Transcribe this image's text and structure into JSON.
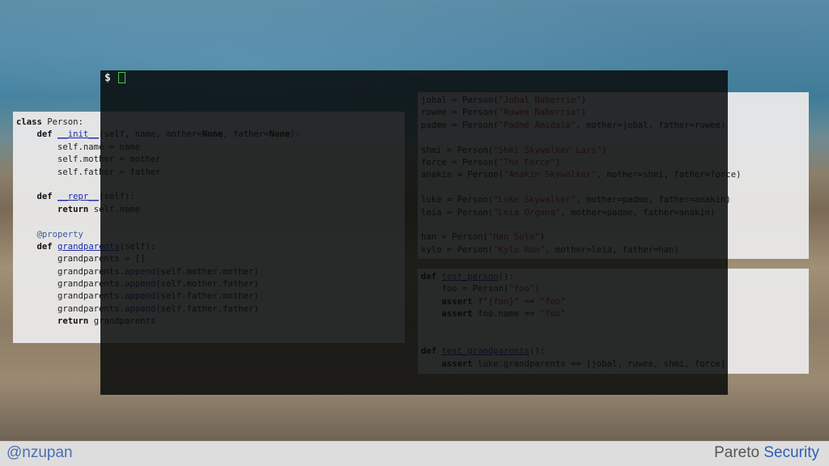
{
  "left_code": {
    "lines": [
      [
        {
          "t": "class",
          "c": "kw"
        },
        {
          "t": " Person:"
        }
      ],
      [
        {
          "t": "    "
        },
        {
          "t": "def",
          "c": "kw"
        },
        {
          "t": " "
        },
        {
          "t": "__init__",
          "c": "fn"
        },
        {
          "t": "(self, name, mother="
        },
        {
          "t": "None",
          "c": "kw"
        },
        {
          "t": ", father="
        },
        {
          "t": "None",
          "c": "kw"
        },
        {
          "t": "):"
        }
      ],
      [
        {
          "t": "        self.name = name"
        }
      ],
      [
        {
          "t": "        self.mother = mother"
        }
      ],
      [
        {
          "t": "        self.father = father"
        }
      ],
      [
        {
          "t": ""
        }
      ],
      [
        {
          "t": "    "
        },
        {
          "t": "def",
          "c": "kw"
        },
        {
          "t": " "
        },
        {
          "t": "__repr__",
          "c": "fn"
        },
        {
          "t": "(self):"
        }
      ],
      [
        {
          "t": "        "
        },
        {
          "t": "return",
          "c": "kw"
        },
        {
          "t": " self.name"
        }
      ],
      [
        {
          "t": ""
        }
      ],
      [
        {
          "t": "    "
        },
        {
          "t": "@property",
          "c": "dec"
        }
      ],
      [
        {
          "t": "    "
        },
        {
          "t": "def",
          "c": "kw"
        },
        {
          "t": " "
        },
        {
          "t": "grandparents",
          "c": "fn"
        },
        {
          "t": "(self):"
        }
      ],
      [
        {
          "t": "        grandparents = []"
        }
      ],
      [
        {
          "t": "        grandparents."
        },
        {
          "t": "append",
          "c": "bi"
        },
        {
          "t": "(self.mother.mother)"
        }
      ],
      [
        {
          "t": "        grandparents."
        },
        {
          "t": "append",
          "c": "bi"
        },
        {
          "t": "(self.mother.father)"
        }
      ],
      [
        {
          "t": "        grandparents."
        },
        {
          "t": "append",
          "c": "bi"
        },
        {
          "t": "(self.father.mother)"
        }
      ],
      [
        {
          "t": "        grandparents."
        },
        {
          "t": "append",
          "c": "bi"
        },
        {
          "t": "(self.father.father)"
        }
      ],
      [
        {
          "t": "        "
        },
        {
          "t": "return",
          "c": "kw"
        },
        {
          "t": " grandparents"
        }
      ]
    ]
  },
  "right_top_code": {
    "lines": [
      [
        {
          "t": "jobal = Person("
        },
        {
          "t": "\"Jobal Naberrie\"",
          "c": "str"
        },
        {
          "t": ")"
        }
      ],
      [
        {
          "t": "ruwee = Person("
        },
        {
          "t": "\"Ruwee Naberrie\"",
          "c": "str"
        },
        {
          "t": ")"
        }
      ],
      [
        {
          "t": "padme = Person("
        },
        {
          "t": "\"Padmé Amidala\"",
          "c": "str"
        },
        {
          "t": ", mother=jobal, father=ruwee)"
        }
      ],
      [
        {
          "t": ""
        }
      ],
      [
        {
          "t": "shmi = Person("
        },
        {
          "t": "\"Shmi Skywalker Lars\"",
          "c": "str"
        },
        {
          "t": ")"
        }
      ],
      [
        {
          "t": "force = Person("
        },
        {
          "t": "\"The Force\"",
          "c": "str"
        },
        {
          "t": ")"
        }
      ],
      [
        {
          "t": "anakin = Person("
        },
        {
          "t": "\"Anakin Skywalker\"",
          "c": "str"
        },
        {
          "t": ", mother=shmi, father=force)"
        }
      ],
      [
        {
          "t": ""
        }
      ],
      [
        {
          "t": "luke = Person("
        },
        {
          "t": "\"Luke Skywalker\"",
          "c": "str"
        },
        {
          "t": ", mother=padme, father=anakin)"
        }
      ],
      [
        {
          "t": "leia = Person("
        },
        {
          "t": "\"Leia Organa\"",
          "c": "str"
        },
        {
          "t": ", mother=padme, father=anakin)"
        }
      ],
      [
        {
          "t": ""
        }
      ],
      [
        {
          "t": "han = Person("
        },
        {
          "t": "\"Han Solo\"",
          "c": "str"
        },
        {
          "t": ")"
        }
      ],
      [
        {
          "t": "kylo = Person("
        },
        {
          "t": "\"Kylo Ren\"",
          "c": "str"
        },
        {
          "t": ", mother=leia, father=han)"
        }
      ]
    ]
  },
  "right_bottom_code": {
    "lines": [
      [
        {
          "t": "def",
          "c": "kw"
        },
        {
          "t": " "
        },
        {
          "t": "test_person",
          "c": "fn"
        },
        {
          "t": "():"
        }
      ],
      [
        {
          "t": "    foo = Person("
        },
        {
          "t": "\"foo\"",
          "c": "str"
        },
        {
          "t": ")"
        }
      ],
      [
        {
          "t": "    "
        },
        {
          "t": "assert",
          "c": "kw"
        },
        {
          "t": " f"
        },
        {
          "t": "\"{foo}\"",
          "c": "str"
        },
        {
          "t": " == "
        },
        {
          "t": "\"foo\"",
          "c": "str"
        }
      ],
      [
        {
          "t": "    "
        },
        {
          "t": "assert",
          "c": "kw"
        },
        {
          "t": " foo.name == "
        },
        {
          "t": "\"foo\"",
          "c": "str"
        }
      ],
      [
        {
          "t": ""
        }
      ],
      [
        {
          "t": ""
        }
      ],
      [
        {
          "t": "def",
          "c": "kw"
        },
        {
          "t": " "
        },
        {
          "t": "test_grandparents",
          "c": "fn"
        },
        {
          "t": "():"
        }
      ],
      [
        {
          "t": "    "
        },
        {
          "t": "assert",
          "c": "kw"
        },
        {
          "t": " luke.grandparents == [jobal, ruwee, shmi, force]"
        }
      ]
    ]
  },
  "terminal": {
    "prompt": "$"
  },
  "footer": {
    "handle": "@nzupan",
    "brand_part1": "Pareto ",
    "brand_part2": "Security"
  }
}
